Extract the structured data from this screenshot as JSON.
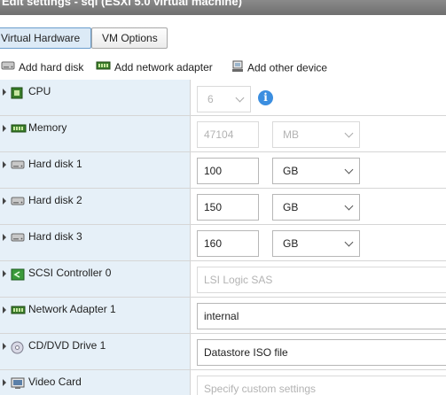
{
  "window": {
    "title": "Edit settings - sql (ESXi 5.0 virtual machine)"
  },
  "tabs": [
    {
      "label": "Virtual Hardware",
      "active": true
    },
    {
      "label": "VM Options",
      "active": false
    }
  ],
  "toolbar": {
    "add_hard_disk": "Add hard disk",
    "add_network_adapter": "Add network adapter",
    "add_other_device": "Add other device"
  },
  "devices": {
    "cpu": {
      "label": "CPU",
      "value": "6"
    },
    "memory": {
      "label": "Memory",
      "value": "47104",
      "unit": "MB"
    },
    "hard_disk_1": {
      "label": "Hard disk 1",
      "value": "100",
      "unit": "GB"
    },
    "hard_disk_2": {
      "label": "Hard disk 2",
      "value": "150",
      "unit": "GB"
    },
    "hard_disk_3": {
      "label": "Hard disk 3",
      "value": "160",
      "unit": "GB"
    },
    "scsi_controller": {
      "label": "SCSI Controller 0",
      "value": "LSI Logic SAS"
    },
    "network_adapter": {
      "label": "Network Adapter 1",
      "value": "internal"
    },
    "cd_dvd_drive": {
      "label": "CD/DVD Drive 1",
      "value": "Datastore ISO file"
    },
    "video_card": {
      "label": "Video Card",
      "value": "Specify custom settings"
    }
  },
  "colors": {
    "tab_active_bg": "#dceaf6",
    "row_label_bg": "#e6f0f8",
    "info_icon": "#3b8ee0"
  }
}
